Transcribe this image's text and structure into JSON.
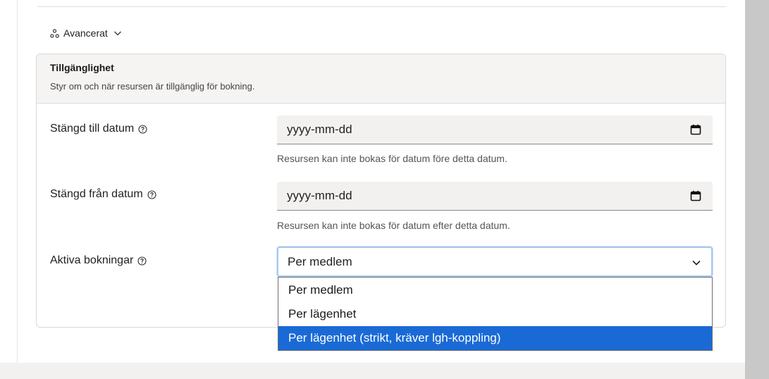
{
  "advanced": {
    "label": "Avancerat"
  },
  "section": {
    "title": "Tillgänglighet",
    "subtitle": "Styr om och när resursen är tillgänglig för bokning."
  },
  "fields": {
    "closed_until": {
      "label": "Stängd till datum",
      "placeholder": "yyyy-mm-dd",
      "hint": "Resursen kan inte bokas för datum före detta datum."
    },
    "closed_from": {
      "label": "Stängd från datum",
      "placeholder": "yyyy-mm-dd",
      "hint": "Resursen kan inte bokas för datum efter detta datum."
    },
    "active_bookings": {
      "label": "Aktiva bokningar",
      "value": "Per medlem",
      "options": [
        "Per medlem",
        "Per lägenhet",
        "Per lägenhet (strikt, kräver lgh-koppling)"
      ],
      "highlighted_option": 2
    }
  },
  "colors": {
    "highlight": "#1a6ad6",
    "focus_ring": "#a9c8f0",
    "input_bg": "#f2f1ef"
  },
  "icons": {
    "advanced": "share-nodes-icon",
    "help": "question-circle-icon",
    "calendar": "calendar-icon",
    "chevron": "chevron-down-icon"
  }
}
